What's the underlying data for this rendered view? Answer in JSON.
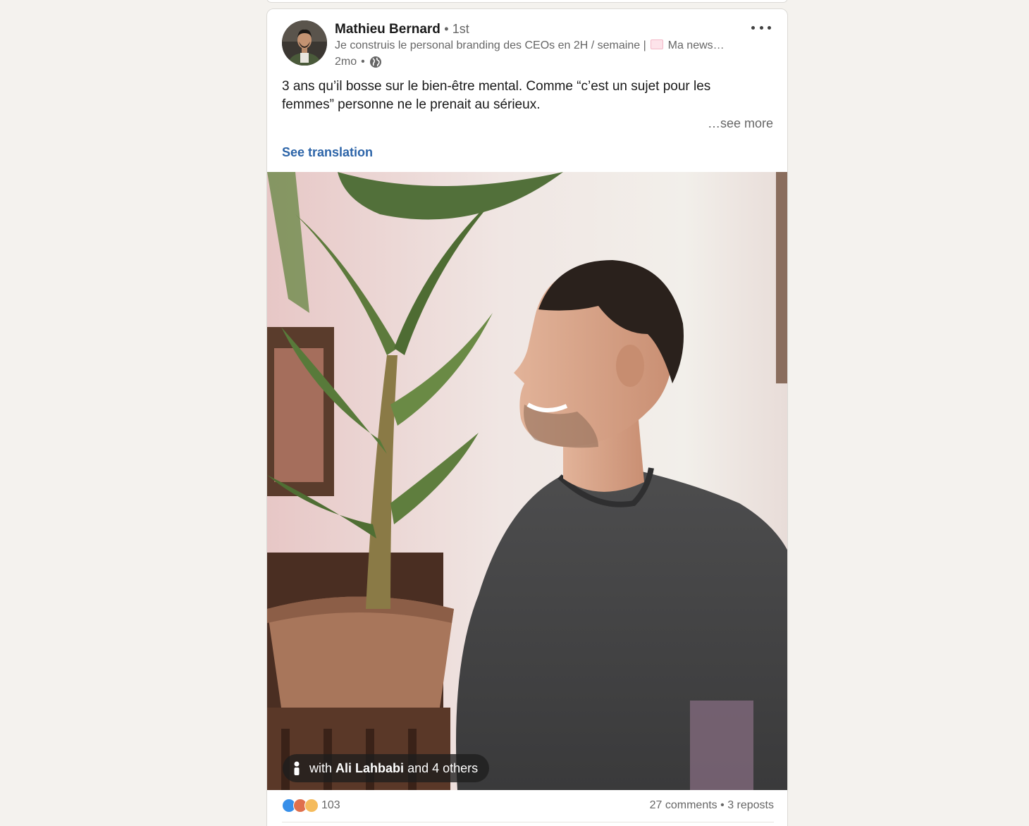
{
  "post": {
    "author": {
      "name": "Mathieu Bernard",
      "degree_separator": "•",
      "degree": "1st",
      "headline_before_emoji": "Je construis le personal branding des CEOs en 2H / semaine | ",
      "headline_after_emoji": " Ma news…",
      "time": "2mo",
      "time_separator": "•",
      "visibility_icon": "globe-icon"
    },
    "text_line1": "3 ans qu’il bosse sur le bien-être mental. Comme “c’est un sujet pour les",
    "text_line2": "femmes” personne ne le prenait au sérieux.",
    "see_more": "…see more",
    "see_translation": "See translation",
    "tag": {
      "prefix": "with",
      "name": "Ali Lahbabi",
      "suffix": "and 4 others"
    },
    "social": {
      "reaction_icons": [
        "like-icon",
        "love-icon",
        "insightful-icon"
      ],
      "reaction_count": "103",
      "comments": "27 comments",
      "separator": "•",
      "reposts": "3 reposts"
    }
  },
  "colors": {
    "page_background": "#f4f2ee",
    "card_background": "#ffffff",
    "link_blue": "#2c64a8",
    "secondary_text": "#666666"
  }
}
